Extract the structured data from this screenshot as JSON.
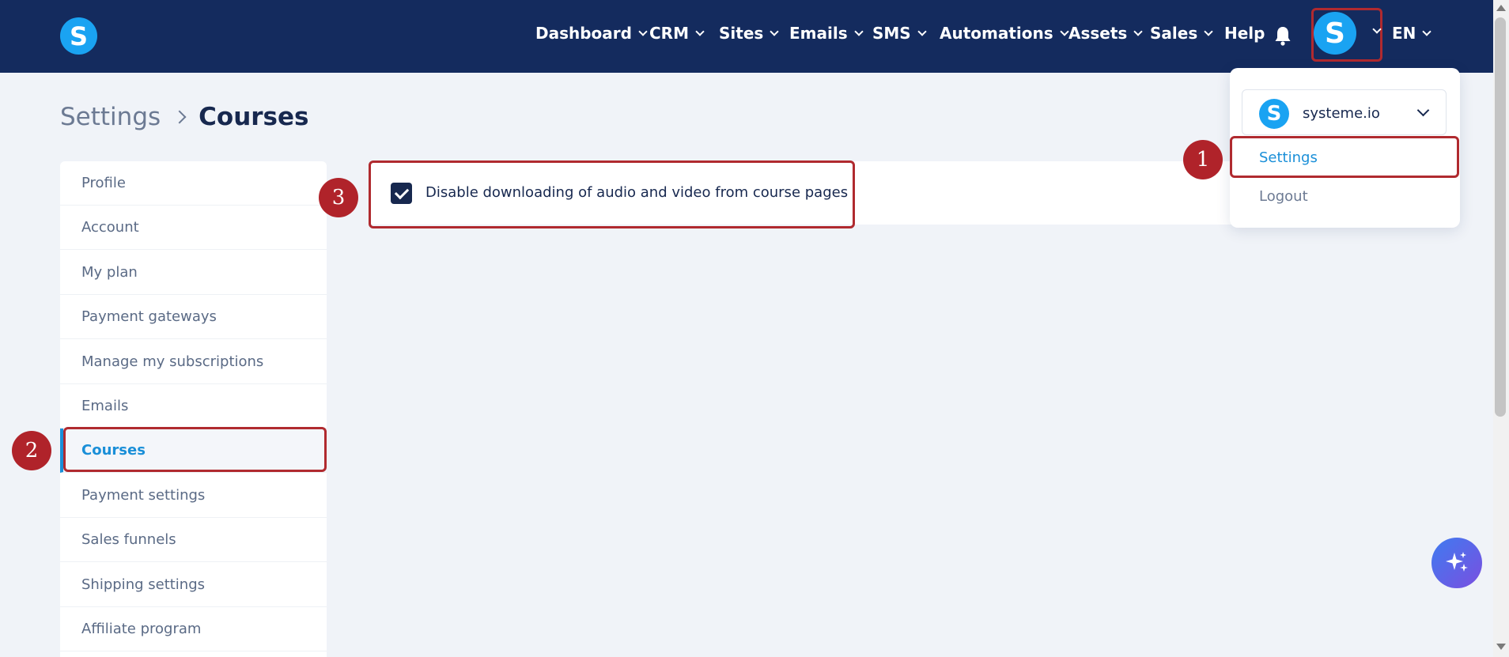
{
  "brand": {
    "logo_letter": "S"
  },
  "nav": {
    "items": [
      {
        "label": "Dashboard",
        "has_menu": true
      },
      {
        "label": "CRM",
        "has_menu": true
      },
      {
        "label": "Sites",
        "has_menu": true
      },
      {
        "label": "Emails",
        "has_menu": true
      },
      {
        "label": "SMS",
        "has_menu": true
      },
      {
        "label": "Automations",
        "has_menu": true
      },
      {
        "label": "Assets",
        "has_menu": true
      },
      {
        "label": "Sales",
        "has_menu": true
      },
      {
        "label": "Help",
        "has_menu": false
      }
    ],
    "avatar_letter": "S",
    "language": "EN"
  },
  "breadcrumb": {
    "parent": "Settings",
    "current": "Courses"
  },
  "sidebar": {
    "items": [
      {
        "label": "Profile"
      },
      {
        "label": "Account"
      },
      {
        "label": "My plan"
      },
      {
        "label": "Payment gateways"
      },
      {
        "label": "Manage my subscriptions"
      },
      {
        "label": "Emails"
      },
      {
        "label": "Courses",
        "active": true
      },
      {
        "label": "Payment settings"
      },
      {
        "label": "Sales funnels"
      },
      {
        "label": "Shipping settings"
      },
      {
        "label": "Affiliate program"
      }
    ]
  },
  "courses_settings": {
    "disable_download_label": "Disable downloading of audio and video from course pages",
    "disable_download_checked": true
  },
  "account_menu": {
    "workspace_logo_letter": "S",
    "workspace_name": "systeme.io",
    "settings_label": "Settings",
    "logout_label": "Logout"
  },
  "annotations": {
    "step1": "1",
    "step2": "2",
    "step3": "3"
  },
  "colors": {
    "topbar": "#142b5e",
    "brand_blue": "#1aa3f2",
    "active_link": "#1a8fd8",
    "highlight_red": "#b02a2f"
  }
}
